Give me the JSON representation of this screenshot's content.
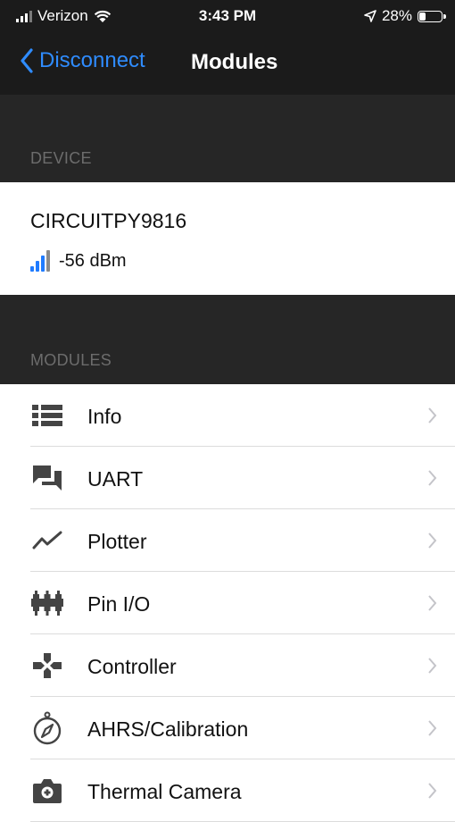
{
  "status_bar": {
    "carrier": "Verizon",
    "time": "3:43 PM",
    "battery_percent": "28%",
    "battery_level": 0.28,
    "icons": [
      "signal-icon",
      "wifi-icon",
      "location-icon",
      "battery-icon"
    ]
  },
  "nav": {
    "back_label": "Disconnect",
    "title": "Modules",
    "accent_color": "#2f8cff"
  },
  "device_section": {
    "header": "DEVICE",
    "device_name": "CIRCUITPY9816",
    "rssi": "-56 dBm",
    "rssi_bars_active": 3,
    "rssi_bars_total": 4,
    "rssi_color": "#1f7bff"
  },
  "modules_section": {
    "header": "MODULES",
    "items": [
      {
        "label": "Info",
        "icon": "list-icon"
      },
      {
        "label": "UART",
        "icon": "chat-icon"
      },
      {
        "label": "Plotter",
        "icon": "line-chart-icon"
      },
      {
        "label": "Pin I/O",
        "icon": "pins-icon"
      },
      {
        "label": "Controller",
        "icon": "gamepad-icon"
      },
      {
        "label": "AHRS/Calibration",
        "icon": "compass-icon"
      },
      {
        "label": "Thermal Camera",
        "icon": "camera-icon"
      }
    ]
  }
}
